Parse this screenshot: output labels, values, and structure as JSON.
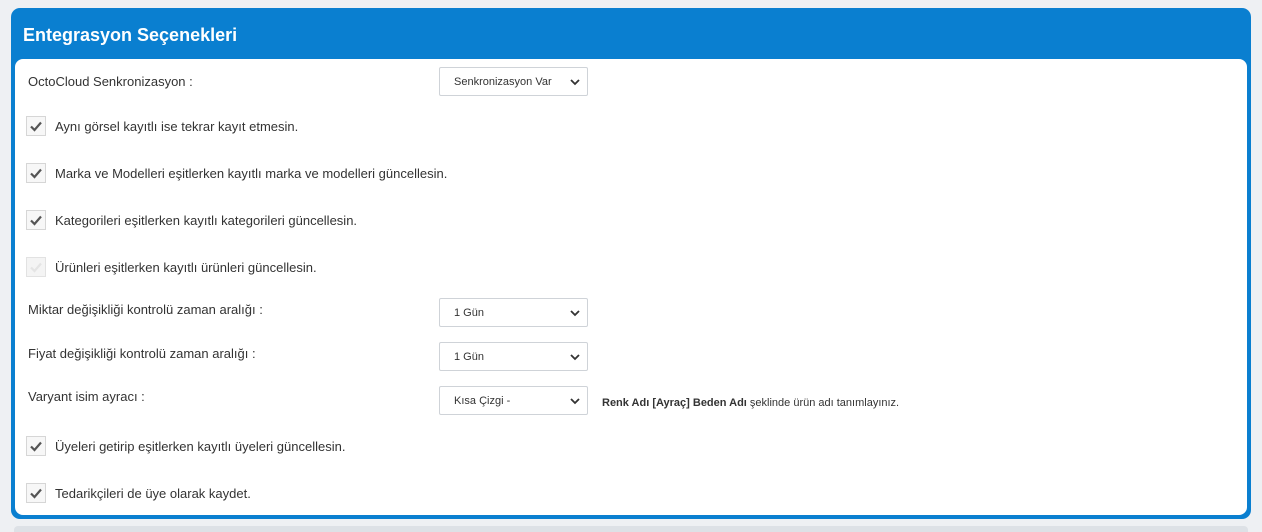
{
  "panel": {
    "title": "Entegrasyon Seçenekleri"
  },
  "sync": {
    "label": "OctoCloud Senkronizasyon :",
    "value": "Senkronizasyon Var"
  },
  "checks": [
    {
      "label": "Aynı görsel kayıtlı ise tekrar kayıt etmesin.",
      "checked": true
    },
    {
      "label": "Marka ve Modelleri eşitlerken kayıtlı marka ve modelleri güncellesin.",
      "checked": true
    },
    {
      "label": "Kategorileri eşitlerken kayıtlı kategorileri güncellesin.",
      "checked": true
    },
    {
      "label": "Ürünleri eşitlerken kayıtlı ürünleri güncellesin.",
      "checked": false
    },
    {
      "label": "Üyeleri getirip eşitlerken kayıtlı üyeleri güncellesin.",
      "checked": true
    },
    {
      "label": "Tedarikçileri de üye olarak kaydet.",
      "checked": true
    }
  ],
  "quantity": {
    "label": "Miktar değişikliği kontrolü zaman aralığı :",
    "value": "1 Gün"
  },
  "price": {
    "label": "Fiyat değişikliği kontrolü zaman aralığı :",
    "value": "1 Gün"
  },
  "variant": {
    "label": "Varyant isim ayracı :",
    "value": "Kısa Çizgi -",
    "hint_bold": "Renk Adı [Ayraç] Beden Adı",
    "hint_rest": " şeklinde ürün adı tanımlayınız."
  },
  "colors": {
    "accent": "#0a7fd0",
    "check": "#555555"
  },
  "icons": {
    "check": "check-icon",
    "select": "chevron-down-icon"
  }
}
